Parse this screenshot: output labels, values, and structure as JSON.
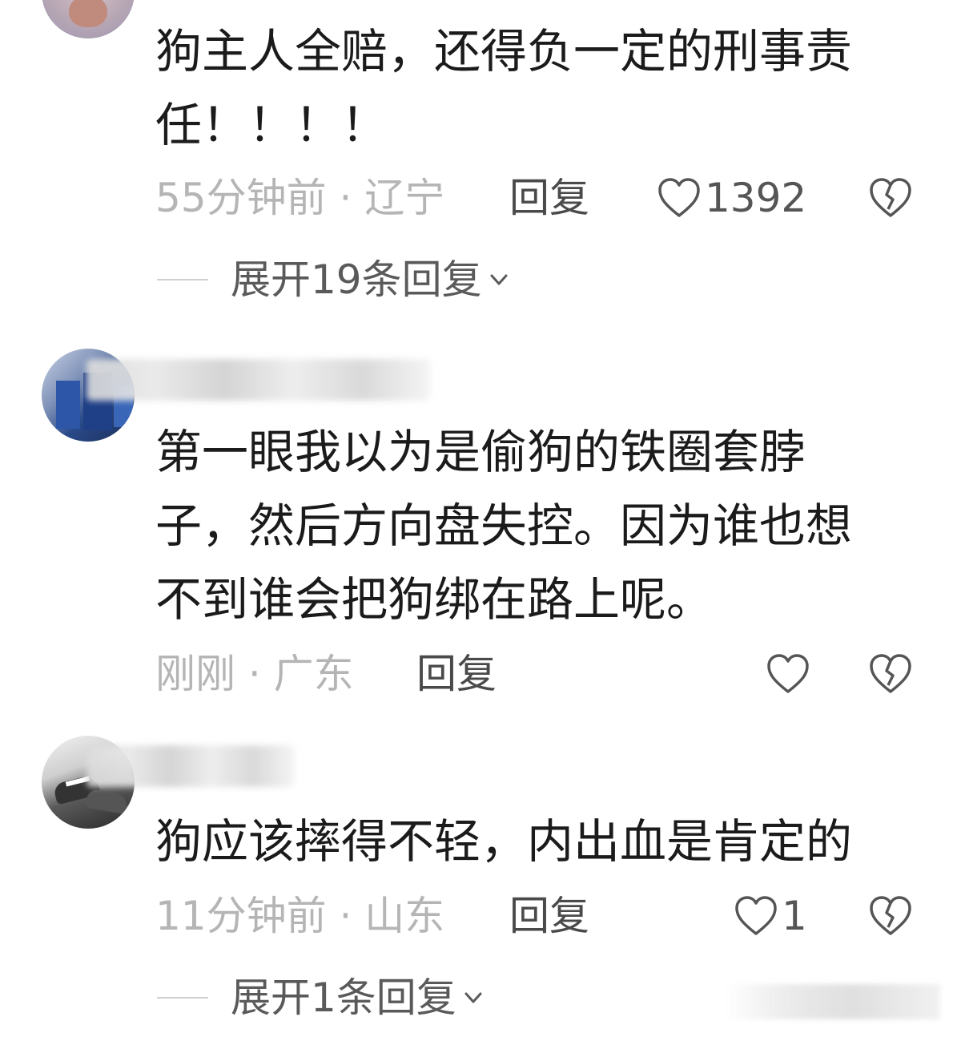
{
  "comments": [
    {
      "text": "狗主人全赔，还得负一定的刑事责\n任！！！！",
      "time_location": "55分钟前 · 辽宁",
      "reply_label": "回复",
      "like_count": "1392",
      "expand_label": "展开19条回复"
    },
    {
      "text": "第一眼我以为是偷狗的铁圈套脖\n子，然后方向盘失控。因为谁也想\n不到谁会把狗绑在路上呢。",
      "time_location": "刚刚 · 广东",
      "reply_label": "回复",
      "like_count": ""
    },
    {
      "text": "狗应该摔得不轻，内出血是肯定的",
      "time_location": "11分钟前 · 山东",
      "reply_label": "回复",
      "like_count": "1",
      "expand_label": "展开1条回复"
    }
  ],
  "icons": {
    "like": "heart-outline-icon",
    "dislike": "broken-heart-icon",
    "expand": "chevron-down-icon"
  },
  "colors": {
    "text": "#1b1b1b",
    "meta": "#b5b5b5",
    "action": "#4a4a4a"
  }
}
